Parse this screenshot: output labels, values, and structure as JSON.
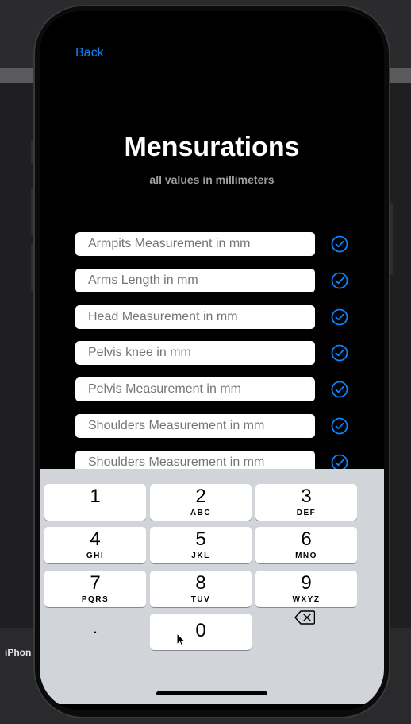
{
  "desktop": {
    "label": "iPhon"
  },
  "nav": {
    "back_label": "Back"
  },
  "header": {
    "title": "Mensurations",
    "subtitle": "all values in millimeters"
  },
  "fields": [
    {
      "placeholder": "Armpits Measurement in mm",
      "value": ""
    },
    {
      "placeholder": "Arms Length in mm",
      "value": ""
    },
    {
      "placeholder": "Head Measurement in mm",
      "value": ""
    },
    {
      "placeholder": "Pelvis knee in mm",
      "value": ""
    },
    {
      "placeholder": "Pelvis Measurement in mm",
      "value": ""
    },
    {
      "placeholder": "Shoulders Measurement in mm",
      "value": ""
    },
    {
      "placeholder": "Shoulders Measurement in mm",
      "value": ""
    }
  ],
  "keyboard": {
    "keys": [
      {
        "num": "1",
        "letters": ""
      },
      {
        "num": "2",
        "letters": "ABC"
      },
      {
        "num": "3",
        "letters": "DEF"
      },
      {
        "num": "4",
        "letters": "GHI"
      },
      {
        "num": "5",
        "letters": "JKL"
      },
      {
        "num": "6",
        "letters": "MNO"
      },
      {
        "num": "7",
        "letters": "PQRS"
      },
      {
        "num": "8",
        "letters": "TUV"
      },
      {
        "num": "9",
        "letters": "WXYZ"
      },
      {
        "num": ".",
        "letters": ""
      },
      {
        "num": "0",
        "letters": ""
      }
    ],
    "delete_icon": "backspace-icon"
  },
  "colors": {
    "accent": "#0a84ff",
    "background": "#000000",
    "keyboard": "#d1d4d9"
  }
}
